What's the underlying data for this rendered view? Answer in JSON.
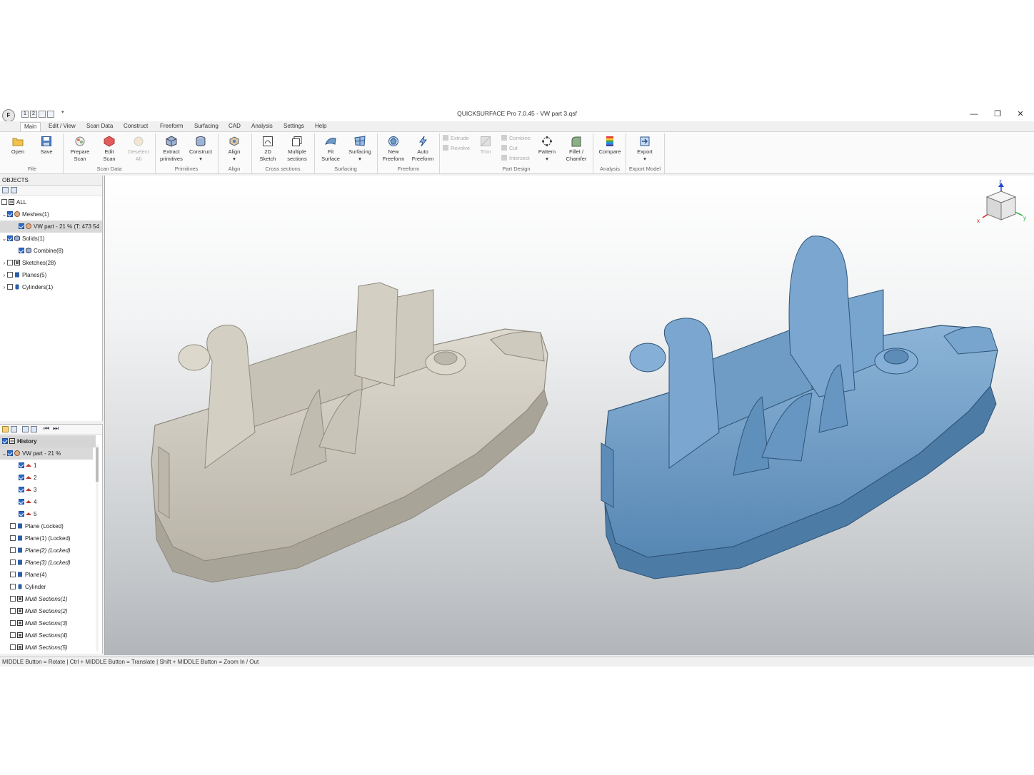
{
  "window": {
    "title": "QUICKSURFACE Pro 7.0.45 - VW part 3.qsf",
    "app_icon_letter": "F",
    "quick_access": [
      "1",
      "2"
    ],
    "controls": {
      "minimize": "—",
      "restore": "❐",
      "close": "✕"
    }
  },
  "menu": {
    "tabs": [
      "Main",
      "Edit / View",
      "Scan Data",
      "Construct",
      "Freeform",
      "Surfacing",
      "CAD",
      "Analysis",
      "Settings",
      "Help"
    ],
    "active": "Main"
  },
  "ribbon": {
    "groups": [
      "File",
      "Scan Data",
      "Primitives",
      "Align",
      "Cross sections",
      "Surfacing",
      "Freeform",
      "Part Design",
      "Analysis",
      "Export Model"
    ],
    "buttons": {
      "open": "Open",
      "save": "Save",
      "prepare_scan": "Prepare\nScan",
      "edit_scan": "Edit\nScan",
      "deselect_all": "Deselect\nAll",
      "extract_primitives": "Extract\nprimitives",
      "construct": "Construct",
      "align": "Align",
      "sketch_2d": "2D\nSketch",
      "multiple_sections": "Multiple\nsections",
      "fit_surface": "Fit\nSurface",
      "surfacing": "Surfacing",
      "new_freeform": "New\nFreeform",
      "auto_freeform": "Auto\nFreeform",
      "extrude": "Extrude",
      "revolve": "Revolve",
      "trim": "Trim",
      "combine": "Combine",
      "cut": "Cut",
      "intersect": "Intersect",
      "pattern": "Pattern",
      "fillet_chamfer": "Fillet /\nChamfer",
      "compare": "Compare",
      "export": "Export"
    },
    "dropdown_arrow": "▾"
  },
  "objects_panel": {
    "header": "OBJECTS",
    "items": [
      {
        "label": "ALL"
      },
      {
        "label": "Meshes(1)"
      },
      {
        "label": "VW part - 21 % (T: 473 54"
      },
      {
        "label": "Solids(1)"
      },
      {
        "label": "Combine(8)"
      },
      {
        "label": "Sketches(28)"
      },
      {
        "label": "Planes(5)"
      },
      {
        "label": "Cylinders(1)"
      }
    ]
  },
  "history_panel": {
    "header": "History",
    "items": [
      {
        "label": "VW part - 21 %"
      },
      {
        "label": "1"
      },
      {
        "label": "2"
      },
      {
        "label": "3"
      },
      {
        "label": "4"
      },
      {
        "label": "5"
      },
      {
        "label": "Plane (Locked)"
      },
      {
        "label": "Plane(1) (Locked)"
      },
      {
        "label": "Plane(2) (Locked)"
      },
      {
        "label": "Plane(3) (Locked)"
      },
      {
        "label": "Plane(4)"
      },
      {
        "label": "Cylinder"
      },
      {
        "label": "Multi Sections(1)"
      },
      {
        "label": "Multi Sections(2)"
      },
      {
        "label": "Multi Sections(3)"
      },
      {
        "label": "Multi Sections(4)"
      },
      {
        "label": "Multi Sections(5)"
      }
    ]
  },
  "viewport": {
    "axis_labels": {
      "z": "z",
      "x": "x",
      "y": "y"
    },
    "colors": {
      "scan_mesh": "#c9c4b8",
      "cad_model": "#6f9cc4",
      "axis_x": "#d21e1e",
      "axis_y": "#22a83a",
      "axis_z": "#2245c8"
    }
  },
  "status": "MIDDLE Button = Rotate | Ctrl + MIDDLE Button = Translate | Shift + MIDDLE Button = Zoom In / Out",
  "colors": {
    "accent": "#2d6bc9",
    "ribbon_bg": "#fafafa",
    "chrome_bg": "#f0f0f0"
  }
}
